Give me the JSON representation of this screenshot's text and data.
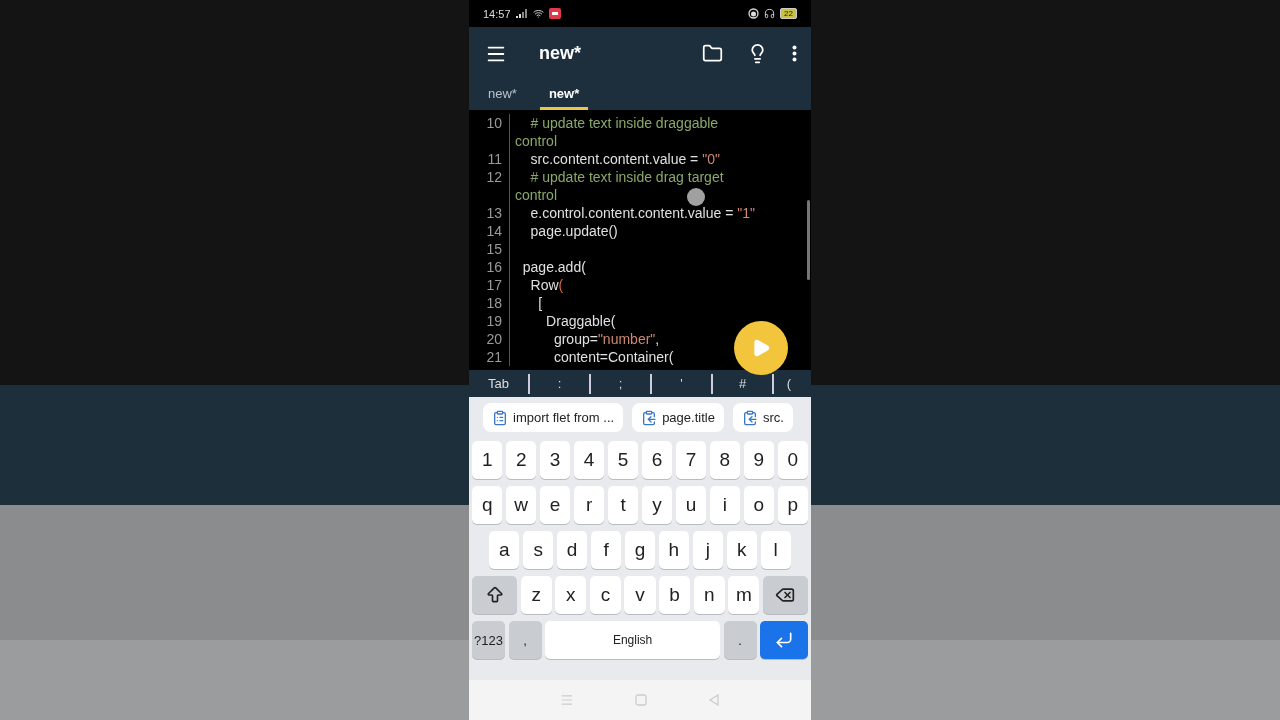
{
  "status_bar": {
    "time": "14:57",
    "battery": "22"
  },
  "app_bar": {
    "title": "new*"
  },
  "tabs": [
    {
      "label": "new*",
      "selected": false
    },
    {
      "label": "new*",
      "selected": true
    }
  ],
  "code_lines": [
    {
      "number": "10",
      "segments": [
        {
          "text": "    # update text inside draggable",
          "kind": "comment"
        }
      ]
    },
    {
      "segments": [
        {
          "text": "control",
          "kind": "comment"
        }
      ]
    },
    {
      "number": "11",
      "segments": [
        {
          "text": "    src.content.content.value = ",
          "kind": "code"
        },
        {
          "text": "\"0\"",
          "kind": "string"
        }
      ]
    },
    {
      "number": "12",
      "segments": [
        {
          "text": "    # update text inside drag target",
          "kind": "comment"
        }
      ]
    },
    {
      "segments": [
        {
          "text": "control",
          "kind": "comment"
        }
      ]
    },
    {
      "number": "13",
      "segments": [
        {
          "text": "    e.control.content.content.value = ",
          "kind": "code"
        },
        {
          "text": "\"1\"",
          "kind": "string"
        }
      ]
    },
    {
      "number": "14",
      "segments": [
        {
          "text": "    page.update()",
          "kind": "code"
        }
      ]
    },
    {
      "number": "15"
    },
    {
      "number": "16",
      "segments": [
        {
          "text": "  page.add(",
          "kind": "code"
        }
      ]
    },
    {
      "number": "17",
      "segments": [
        {
          "text": "    Row",
          "kind": "code"
        },
        {
          "text": "(",
          "kind": "paren"
        }
      ]
    },
    {
      "number": "18",
      "segments": [
        {
          "text": "      [",
          "kind": "code"
        }
      ]
    },
    {
      "number": "19",
      "segments": [
        {
          "text": "        Draggable(",
          "kind": "code"
        }
      ]
    },
    {
      "number": "20",
      "segments": [
        {
          "text": "          group=",
          "kind": "code"
        },
        {
          "text": "\"number\"",
          "kind": "string"
        },
        {
          "text": ",",
          "kind": "code"
        }
      ]
    },
    {
      "number": "21",
      "segments": [
        {
          "text": "          content=Container(",
          "kind": "code"
        }
      ]
    }
  ],
  "extra_keys": [
    "Tab",
    ":",
    ";",
    "'",
    "#",
    "("
  ],
  "clipboard_chips": [
    {
      "label": "import flet from ...",
      "kind": "text"
    },
    {
      "label": "page.title",
      "kind": "link"
    },
    {
      "label": "src.",
      "kind": "link"
    }
  ],
  "keyboard_rows": [
    [
      {
        "label": "1",
        "kind": "char"
      },
      {
        "label": "2",
        "kind": "char"
      },
      {
        "label": "3",
        "kind": "char"
      },
      {
        "label": "4",
        "kind": "char"
      },
      {
        "label": "5",
        "kind": "char"
      },
      {
        "label": "6",
        "kind": "char"
      },
      {
        "label": "7",
        "kind": "char"
      },
      {
        "label": "8",
        "kind": "char"
      },
      {
        "label": "9",
        "kind": "char"
      },
      {
        "label": "0",
        "kind": "char"
      }
    ],
    [
      {
        "label": "q",
        "kind": "char"
      },
      {
        "label": "w",
        "kind": "char"
      },
      {
        "label": "e",
        "kind": "char"
      },
      {
        "label": "r",
        "kind": "char"
      },
      {
        "label": "t",
        "kind": "char"
      },
      {
        "label": "y",
        "kind": "char"
      },
      {
        "label": "u",
        "kind": "char"
      },
      {
        "label": "i",
        "kind": "char"
      },
      {
        "label": "o",
        "kind": "char"
      },
      {
        "label": "p",
        "kind": "char"
      }
    ],
    [
      {
        "label": "a",
        "kind": "char"
      },
      {
        "label": "s",
        "kind": "char"
      },
      {
        "label": "d",
        "kind": "char"
      },
      {
        "label": "f",
        "kind": "char"
      },
      {
        "label": "g",
        "kind": "char"
      },
      {
        "label": "h",
        "kind": "char"
      },
      {
        "label": "j",
        "kind": "char"
      },
      {
        "label": "k",
        "kind": "char"
      },
      {
        "label": "l",
        "kind": "char"
      }
    ],
    [
      {
        "kind": "shift"
      },
      {
        "label": "z",
        "kind": "char"
      },
      {
        "label": "x",
        "kind": "char"
      },
      {
        "label": "c",
        "kind": "char"
      },
      {
        "label": "v",
        "kind": "char"
      },
      {
        "label": "b",
        "kind": "char"
      },
      {
        "label": "n",
        "kind": "char"
      },
      {
        "label": "m",
        "kind": "char"
      },
      {
        "kind": "backspace"
      }
    ],
    [
      {
        "label": "?123",
        "kind": "mode"
      },
      {
        "label": ",",
        "kind": "mode"
      },
      {
        "label": "English",
        "kind": "space"
      },
      {
        "label": ".",
        "kind": "mode"
      },
      {
        "kind": "enter"
      }
    ]
  ]
}
